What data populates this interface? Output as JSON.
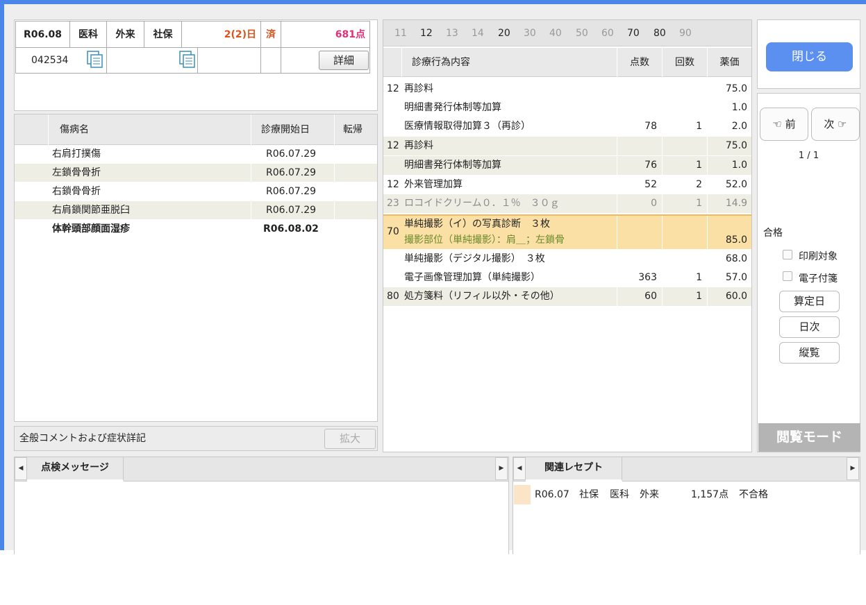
{
  "header": {
    "date": "R06.08",
    "dept": "医科",
    "visit_type": "外来",
    "insurance": "社保",
    "days": "2(2)日",
    "status": "済",
    "points": "681点",
    "patient_id": "042534",
    "detail_button": "詳細"
  },
  "disease_table": {
    "columns": [
      "傷病名",
      "診療開始日",
      "転帰"
    ],
    "rows": [
      {
        "name": "右肩打撲傷",
        "date": "R06.07.29",
        "outcome": ""
      },
      {
        "name": "左鎖骨骨折",
        "date": "R06.07.29",
        "outcome": ""
      },
      {
        "name": "右鎖骨骨折",
        "date": "R06.07.29",
        "outcome": ""
      },
      {
        "name": "右肩鎖関節亜脱臼",
        "date": "R06.07.29",
        "outcome": ""
      },
      {
        "name": "体幹頭部顔面湿疹",
        "date": "R06.08.02",
        "outcome": ""
      }
    ]
  },
  "comment_bar": {
    "label": "全般コメントおよび症状詳記",
    "expand_button": "拡大"
  },
  "code_tabs": [
    "11",
    "12",
    "13",
    "14",
    "20",
    "30",
    "40",
    "50",
    "60",
    "70",
    "80",
    "90"
  ],
  "treatment_table": {
    "columns": [
      "診療行為内容",
      "点数",
      "回数",
      "薬価"
    ],
    "rows": [
      {
        "code": "12",
        "content": "再診料",
        "points": "",
        "count": "",
        "price": "75.0"
      },
      {
        "code": "",
        "content": "明細書発行体制等加算",
        "points": "",
        "count": "",
        "price": "1.0"
      },
      {
        "code": "",
        "content": "医療情報取得加算３（再診）",
        "points": "78",
        "count": "1",
        "price": "2.0"
      },
      {
        "code": "12",
        "content": "再診料",
        "points": "",
        "count": "",
        "price": "75.0"
      },
      {
        "code": "",
        "content": "明細書発行体制等加算",
        "points": "76",
        "count": "1",
        "price": "1.0"
      },
      {
        "code": "12",
        "content": "外来管理加算",
        "points": "52",
        "count": "2",
        "price": "52.0"
      },
      {
        "code": "23",
        "content": "ロコイドクリーム０．１％　３０ｇ",
        "points": "0",
        "count": "1",
        "price": "14.9"
      },
      {
        "code": "70",
        "content": "単純撮影（イ）の写真診断　３枚",
        "sub": "撮影部位（単純撮影）：肩＿；左鎖骨",
        "points": "",
        "count": "",
        "price": "85.0"
      },
      {
        "code": "",
        "content": "単純撮影（デジタル撮影）　３枚",
        "points": "",
        "count": "",
        "price": "68.0"
      },
      {
        "code": "",
        "content": "電子画像管理加算（単純撮影）",
        "points": "363",
        "count": "1",
        "price": "57.0"
      },
      {
        "code": "80",
        "content": "処方箋料（リフィル以外・その他）",
        "points": "60",
        "count": "1",
        "price": "60.0"
      }
    ]
  },
  "right_panel": {
    "close_button": "閉じる",
    "prev_button": "前",
    "next_button": "次",
    "page_indicator": "1 / 1",
    "result_label": "合格",
    "print_target_label": "印刷対象",
    "electronic_tag_label": "電子付箋",
    "calc_date_button": "算定日",
    "daily_button": "日次",
    "vertical_view_button": "縦覧",
    "mode_label": "閲覧モード"
  },
  "check_messages": {
    "tab_label": "点検メッセージ"
  },
  "related_receipts": {
    "tab_label": "関連レセプト",
    "rows": [
      {
        "date": "R06.07",
        "insurance": "社保",
        "dept": "医科",
        "visit_type": "外来",
        "points": "1,157点",
        "result": "不合格"
      }
    ]
  },
  "colors": {
    "frame_blue": "#4a86e8",
    "close_button_blue": "#5b8ff0",
    "days_orange": "#d9531e",
    "points_pink": "#e0307a",
    "selected_row": "#fbe0a6",
    "sub_green": "#6a8a2a",
    "row_shade": "#efeee5"
  }
}
